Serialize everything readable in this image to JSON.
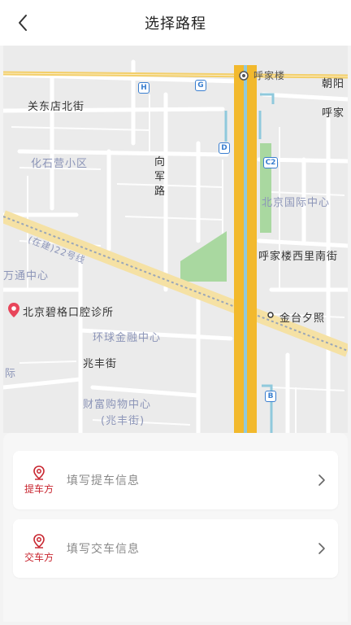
{
  "header": {
    "title": "选择路程"
  },
  "map": {
    "labels": {
      "huajialou": "呼家楼",
      "chaoyang": "朝阳",
      "huajia_right": "呼家",
      "guandongdian": "关东店北街",
      "huashiying": "化石营小区",
      "xiang": "向",
      "jun": "军",
      "lu": "路",
      "intl_center": "北京国际中心",
      "huajialou_xili": "呼家楼西里南街",
      "wantong": "万通中心",
      "bikege": "北京碧格口腔诊所",
      "jintai": "金台夕照",
      "huanqiu": "环球金融中心",
      "zhaofeng": "兆丰街",
      "ji": "际",
      "caifu_1": "财富购物中心",
      "caifu_2": "(兆丰街)",
      "rail": "(在建)22号线"
    },
    "tags": {
      "h": "H",
      "g": "G",
      "d": "D",
      "c2": "C2",
      "b": "B"
    }
  },
  "pickup": {
    "role": "提车方",
    "placeholder": "填写提车信息"
  },
  "dropoff": {
    "role": "交车方",
    "placeholder": "填写交车信息"
  },
  "colors": {
    "accent": "#c8252f",
    "highway": "#f4c443"
  }
}
